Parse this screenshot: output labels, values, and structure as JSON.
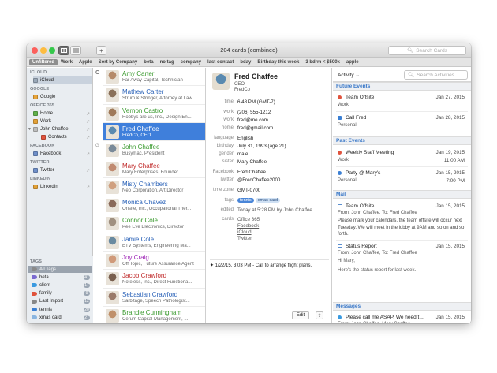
{
  "window": {
    "title": "204 cards (combined)",
    "search_placeholder": "Search Cards",
    "add_label": "+",
    "traffic_lights": [
      "#fc605c",
      "#fdbc40",
      "#34c84a"
    ]
  },
  "tagbar": [
    "Unfiltered",
    "Work",
    "Apple",
    "Sort by Company",
    "beta",
    "no tag",
    "company",
    "last contact",
    "bday",
    "Birthday this week",
    "3 bdrm < $500k",
    "apple"
  ],
  "sidebar": {
    "sections": [
      {
        "title": "ICLOUD",
        "items": [
          {
            "label": "iCloud",
            "color": "#9aa8b8",
            "selected": true
          }
        ]
      },
      {
        "title": "GOOGLE",
        "items": [
          {
            "label": "Google",
            "color": "#e8a43a",
            "selected": false
          }
        ]
      },
      {
        "title": "OFFICE 365",
        "items": [
          {
            "label": "Home",
            "color": "#5fb04a",
            "selected": false
          },
          {
            "label": "Work",
            "color": "#e2a137",
            "selected": false
          },
          {
            "label": "John Chaffee",
            "color": "#bdbdbd",
            "selected": false
          },
          {
            "label": "Contacts",
            "color": "#e0533d",
            "selected": false
          }
        ]
      },
      {
        "title": "FACEBOOK",
        "items": [
          {
            "label": "Facebook",
            "color": "#6f8fc9",
            "selected": false
          }
        ]
      },
      {
        "title": "TWITTER",
        "items": [
          {
            "label": "Twitter",
            "color": "#6f8fc9",
            "selected": false
          }
        ]
      },
      {
        "title": "LINKEDIN",
        "items": [
          {
            "label": "LinkedIn",
            "color": "#e2a137",
            "selected": false
          }
        ]
      }
    ],
    "tags_title": "TAGS",
    "tags": [
      {
        "label": "All Tags",
        "color": "#8a8a8a",
        "count": ""
      },
      {
        "label": "beta",
        "color": "#7b6bd1",
        "count": "41"
      },
      {
        "label": "client",
        "color": "#3a9ae0",
        "count": "17"
      },
      {
        "label": "family",
        "color": "#e0533d",
        "count": "9"
      },
      {
        "label": "Last Import",
        "color": "#888888",
        "count": "12"
      },
      {
        "label": "tennis",
        "color": "#3a7fd4",
        "count": "20"
      },
      {
        "label": "xmas card",
        "color": "#8ab5e0",
        "count": "27"
      }
    ]
  },
  "letters": [
    {
      "text": "C",
      "row": 0
    },
    {
      "text": "G",
      "row": 4
    }
  ],
  "contacts": [
    {
      "name": "Amy Carter",
      "sub": "Far Away Capital, Technician",
      "color": "#3a9a2e",
      "av": "#b58a6a"
    },
    {
      "name": "Mathew Carter",
      "sub": "Strum & Stringer, Attorney at Law",
      "color": "#2a62b8",
      "av": "#8a7059"
    },
    {
      "name": "Vernon Castro",
      "sub": "Hobbys are us, Inc., Design En...",
      "color": "#3a9a2e",
      "av": "#a07a5a"
    },
    {
      "name": "Fred Chaffee",
      "sub": "FredCo, CEO",
      "color": "#ffffff",
      "av": "#5a8ab0",
      "selected": true
    },
    {
      "name": "John Chaffee",
      "sub": "Busymac, President",
      "color": "#3a9a2e",
      "av": "#7a8a99"
    },
    {
      "name": "Mary Chaffee",
      "sub": "Mary Enterprises, Founder",
      "color": "#c02a2a",
      "av": "#c08a70"
    },
    {
      "name": "Misty Chambers",
      "sub": "Neo Corporation, Art Director",
      "color": "#2a62b8",
      "av": "#d0a080"
    },
    {
      "name": "Monica Chavez",
      "sub": "Onsite, Inc., Occupational Ther...",
      "color": "#2a62b8",
      "av": "#8a6a5a"
    },
    {
      "name": "Connor Cole",
      "sub": "Pee Eve Electronics, Director",
      "color": "#3a9a2e",
      "av": "#a09080"
    },
    {
      "name": "Jamie Cole",
      "sub": "ETV Systems, Engineering Ma...",
      "color": "#2a62b8",
      "av": "#6a8aa0"
    },
    {
      "name": "Joy Craig",
      "sub": "Off Topic, Future Assurance Agent",
      "color": "#a02ab8",
      "av": "#d09a7a"
    },
    {
      "name": "Jacob Crawford",
      "sub": "Noteless, Inc., Direct Functiona...",
      "color": "#c02a2a",
      "av": "#7a6050"
    },
    {
      "name": "Sebastian Crawford",
      "sub": "Sarbitage, Speech Pathologist...",
      "color": "#2a62b8",
      "av": "#9a7a6a"
    },
    {
      "name": "Brandie Cunningham",
      "sub": "Cerum Capital Management, ...",
      "color": "#3a9a2e",
      "av": "#c0906a"
    }
  ],
  "detail": {
    "name": "Fred Chaffee",
    "title": "CEO",
    "company": "FredCo",
    "fields": [
      {
        "label": "time",
        "value": "6:48 PM (GMT-7)"
      },
      {
        "label": "work",
        "value": "(206) 555-1212"
      },
      {
        "label": "work",
        "value": "fred@me.com"
      },
      {
        "label": "home",
        "value": "fred@gmail.com"
      },
      {
        "label": "language",
        "value": "English"
      },
      {
        "label": "birthday",
        "value": "July 31, 1993 (age 21)"
      },
      {
        "label": "gender",
        "value": "male"
      },
      {
        "label": "sister",
        "value": "Mary Chaffee"
      },
      {
        "label": "Facebook",
        "value": "Fred Chaffee"
      },
      {
        "label": "Twitter",
        "value": "@FredChaffee2000"
      },
      {
        "label": "time zone",
        "value": "GMT-0700"
      }
    ],
    "tags_label": "tags",
    "tags": [
      {
        "label": "tennis",
        "bg": "#4a86d8",
        "fg": "#ffffff"
      },
      {
        "label": "xmas card",
        "bg": "#cfe0f3",
        "fg": "#2a4f80"
      }
    ],
    "edited_label": "edited",
    "edited": "Today at 5:28 PM by John Chaffee",
    "cards_label": "cards",
    "cards": [
      "Office 365",
      "Facebook",
      "iCloud",
      "Twitter"
    ],
    "note": "1/22/15, 3:03 PM - Call to arrange flight plans.",
    "edit_label": "Edit"
  },
  "activity": {
    "dropdown": "Activity",
    "search_placeholder": "Search Activities",
    "future_title": "Future Events",
    "future": [
      {
        "title": "Team Offsite",
        "date": "Jan 27, 2015",
        "sub": "Work",
        "color": "#e0533d",
        "shape": "dot"
      },
      {
        "title": "Call Fred",
        "date": "Jan 28, 2015",
        "sub": "Personal",
        "color": "#3a7fd4",
        "shape": "sq"
      }
    ],
    "past_title": "Past Events",
    "past": [
      {
        "title": "Weekly Staff Meeting",
        "date": "Jan 19, 2015",
        "time": "11:00 AM",
        "sub": "Work",
        "color": "#e0533d"
      },
      {
        "title": "Party @ Mary's",
        "date": "Jan 15, 2015",
        "time": "7:00 PM",
        "sub": "Personal",
        "color": "#3a7fd4"
      }
    ],
    "mail_title": "Mail",
    "mail": [
      {
        "title": "Team Offsite",
        "date": "Jan 15, 2015",
        "from": "From: John Chaffee, To: Fred Chaffee",
        "body": "Please mark your calendars, the team offsite will occur next Tuesday. We will meet in the lobby at 9AM and so on and so forth."
      },
      {
        "title": "Status Report",
        "date": "Jan 15, 2015",
        "from": "From: John Chaffee, To: Fred Chaffee",
        "body1": "Hi Mary,",
        "body2": "Here's the status report for last week."
      }
    ],
    "messages_title": "Messages",
    "messages": [
      {
        "title": "Please call me ASAP. We need t...",
        "date": "Jan 15, 2015",
        "from": "From: John Chaffee, Mary Chaffee"
      }
    ]
  }
}
